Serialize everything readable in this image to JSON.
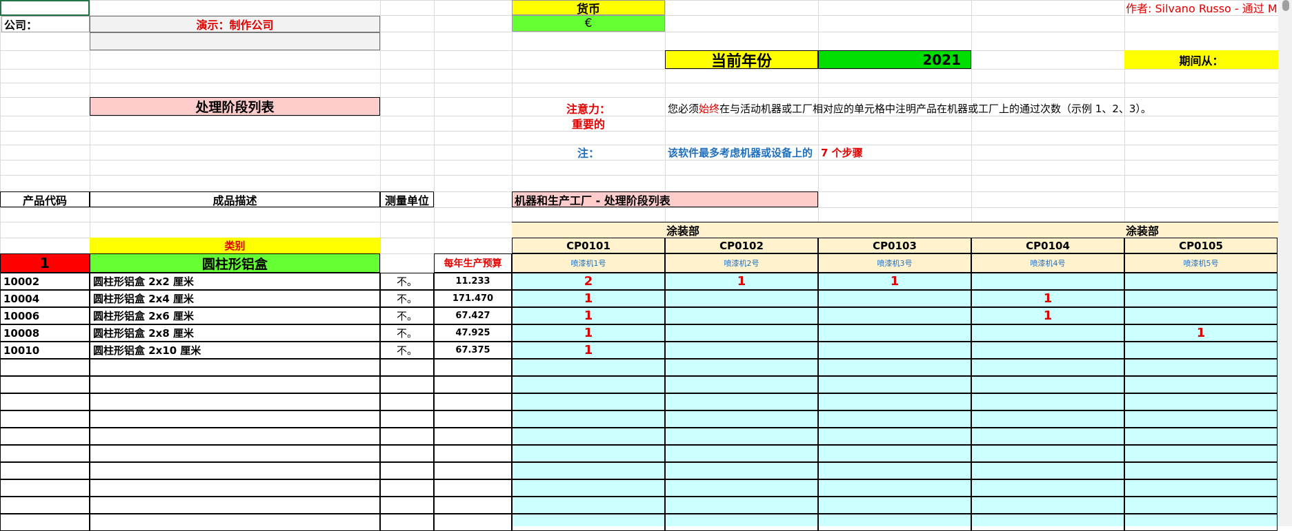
{
  "header": {
    "currency_label": "货币",
    "currency_value": "€",
    "company_label": "公司：",
    "company_value": "演示：制作公司",
    "author": "作者: Silvano Russo - 通过 M. D",
    "current_year_label": "当前年份",
    "current_year_value": "2021",
    "period_from_label": "期间从："
  },
  "section_title": "处理阶段列表",
  "attention": {
    "label_1": "注意力：",
    "label_2": "重要的",
    "text_pre": "您必须",
    "text_red": "始终",
    "text_post": "在与活动机器或工厂相对应的单元格中注明产品在机器或工厂上的通过次数（示例 1、2、3）。"
  },
  "note": {
    "label": "注：",
    "text": "该软件最多考虑机器或设备上的",
    "steps": "7 个步骤"
  },
  "table_headers": {
    "product_code": "产品代码",
    "product_desc": "成品描述",
    "unit": "测量单位",
    "machines_title": "机器和生产工厂 - 处理阶段列表"
  },
  "category": {
    "label": "类别",
    "number": "1",
    "name": "圆柱形铝盒",
    "budget_label": "每年生产预算"
  },
  "departments": [
    "涂装部",
    "涂装部"
  ],
  "machines": [
    {
      "code": "CP0101",
      "name": "喷漆机1号"
    },
    {
      "code": "CP0102",
      "name": "喷漆机2号"
    },
    {
      "code": "CP0103",
      "name": "喷漆机3号"
    },
    {
      "code": "CP0104",
      "name": "喷漆机4号"
    },
    {
      "code": "CP0105",
      "name": "喷漆机5号"
    }
  ],
  "products": [
    {
      "code": "10002",
      "desc": "圆柱形铝盒 2x2 厘米",
      "unit": "不。",
      "budget": "11.233",
      "passes": [
        "2",
        "1",
        "1",
        "",
        ""
      ]
    },
    {
      "code": "10004",
      "desc": "圆柱形铝盒 2x4 厘米",
      "unit": "不。",
      "budget": "171.470",
      "passes": [
        "1",
        "",
        "",
        "1",
        ""
      ]
    },
    {
      "code": "10006",
      "desc": "圆柱形铝盒 2x6 厘米",
      "unit": "不。",
      "budget": "67.427",
      "passes": [
        "1",
        "",
        "",
        "1",
        ""
      ]
    },
    {
      "code": "10008",
      "desc": "圆柱形铝盒 2x8 厘米",
      "unit": "不。",
      "budget": "47.925",
      "passes": [
        "1",
        "",
        "",
        "",
        "1"
      ]
    },
    {
      "code": "10010",
      "desc": "圆柱形铝盒 2x10 厘米",
      "unit": "不。",
      "budget": "67.375",
      "passes": [
        "1",
        "",
        "",
        "",
        ""
      ]
    }
  ],
  "colors": {
    "yellow": "#ffff00",
    "green": "#66ff33",
    "pink": "#ffcccc",
    "red": "#ff0000",
    "cyan": "#ccffff",
    "peach": "#fff2cc",
    "blue_text": "#1f6fbf",
    "red_text": "#e00000"
  }
}
